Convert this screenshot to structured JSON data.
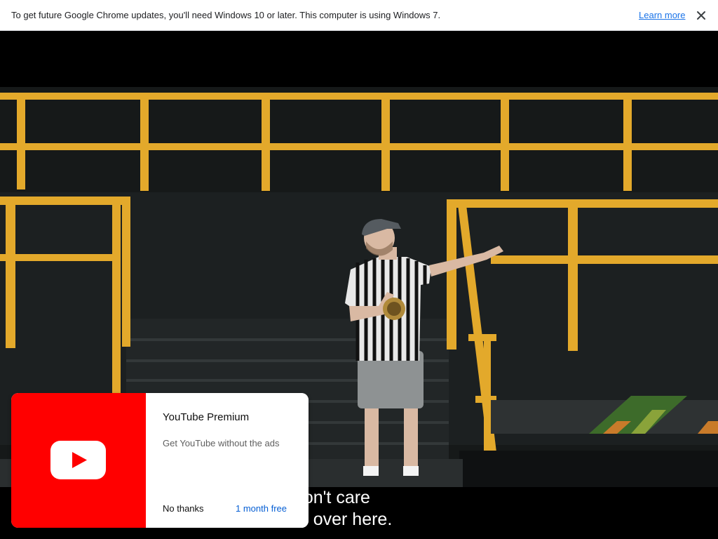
{
  "infobar": {
    "message": "To get future Google Chrome updates, you'll need Windows 10 or later. This computer is using Windows 7.",
    "learn_more": "Learn more",
    "close_icon": "close-icon"
  },
  "captions": {
    "line1": "ve on. I don't care",
    "line2": "e five four over here."
  },
  "promo": {
    "title": "YouTube Premium",
    "subtitle": "Get YouTube without the ads",
    "no_thanks": "No thanks",
    "cta": "1 month free",
    "logo_icon": "youtube-logo-icon",
    "brand_color": "#ff0000",
    "cta_color": "#065fd4"
  },
  "colors": {
    "railing": "#e0a82a",
    "stage_bg": "#1b1e1f"
  }
}
